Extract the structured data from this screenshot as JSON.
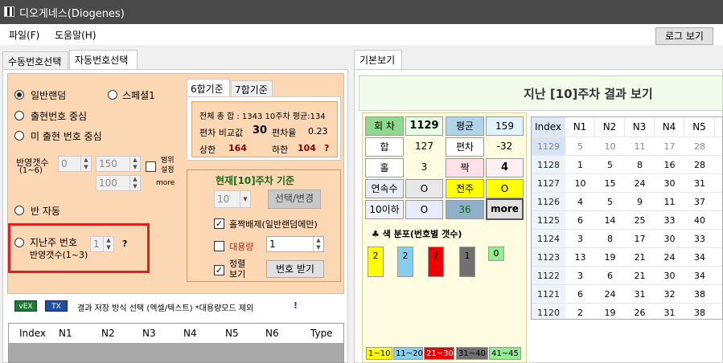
{
  "window": {
    "title": "디오게네스(Diogenes)"
  },
  "menu": {
    "file": "파일(F)",
    "help": "도움말(H)",
    "log_button": "로그 보기"
  },
  "left_tabs": {
    "manual": "수동번호선택",
    "auto": "자동번호선택"
  },
  "right_tabs": {
    "basic": "기본보기"
  },
  "options": {
    "normal_random": "일반랜덤",
    "special1": "스페셜1",
    "drawn_center": "출현번호 중심",
    "undrawn_center": "미 출현 번호 중심",
    "reflect_count_label": "반영갯수",
    "reflect_count_range": "(1~6)",
    "reflect_value": "0",
    "range_value1": "150",
    "range_value2": "100",
    "range_setting": "범위\n설정",
    "more": "more",
    "semi_auto": "반 자동",
    "last_week_number": "지난주 번호",
    "last_week_reflect": "반영갯수(1~3)",
    "last_week_value": "1",
    "question": "?"
  },
  "combo_tabs": {
    "six": "6합기준",
    "seven": "7합기준"
  },
  "summary": {
    "total_line": "전체 총 합 : 1343  10주차 평균:134",
    "deviation_label": "편차 비교값",
    "deviation_value": "30",
    "deviation_rate_label": "편차율",
    "deviation_rate": "0.23",
    "upper_label": "상한",
    "upper": "164",
    "lower_label": "하한",
    "lower": "104",
    "q": "?"
  },
  "current": {
    "title": "현재[10]주차 기준",
    "week_value": "10",
    "select_button": "선택/변경",
    "oddeven_exclude": "홀짝배제(일반랜덤에만)",
    "bulk_label": "대용량",
    "bulk_value": "1",
    "sort_label": "정렬\n보기",
    "get_numbers_button": "번호 받기"
  },
  "save": {
    "label": "결과 저장 방식 선택 (엑셀/텍스트) *대용량모드 제외",
    "excl": "!",
    "excel_icon": "vEX",
    "text_icon": "TX"
  },
  "bottom_table": {
    "headers": [
      "Index",
      "N1",
      "N2",
      "N3",
      "N4",
      "N5",
      "N6",
      "Type"
    ]
  },
  "result": {
    "title": "지난 [10]주차 결과 보기"
  },
  "stats": {
    "round_label": "회 차",
    "round": "1129",
    "avg_label": "평균",
    "avg": "159",
    "sum_label": "합",
    "sum": "127",
    "dev_label": "편차",
    "dev": "-32",
    "odd_label": "홀",
    "odd": "3",
    "even_label": "짝",
    "even": "4",
    "consec_label": "연속수",
    "consec": "O",
    "prev_label": "전주",
    "prev": "O",
    "under10_label": "10이하",
    "under10": "O",
    "s36": "36",
    "more_button": "more"
  },
  "color_dist": {
    "title": "♣ 색 분포(번호별 갯수)",
    "counts": [
      "2",
      "2",
      "2",
      "1",
      "0"
    ],
    "colors": [
      "#ffff00",
      "#87ceeb",
      "#ee0000",
      "#707070",
      "#90ee90"
    ],
    "legend": [
      "1~10",
      "11~20",
      "21~30",
      "31~40",
      "41~45"
    ]
  },
  "history": {
    "headers": [
      "Index",
      "N1",
      "N2",
      "N3",
      "N4",
      "N5"
    ],
    "rows": [
      [
        "1129",
        "5",
        "10",
        "11",
        "17",
        "28"
      ],
      [
        "1128",
        "1",
        "5",
        "8",
        "16",
        "28"
      ],
      [
        "1127",
        "10",
        "15",
        "24",
        "30",
        "31"
      ],
      [
        "1126",
        "4",
        "5",
        "9",
        "11",
        "37"
      ],
      [
        "1125",
        "6",
        "14",
        "25",
        "33",
        "40"
      ],
      [
        "1124",
        "3",
        "8",
        "17",
        "30",
        "33"
      ],
      [
        "1123",
        "13",
        "19",
        "21",
        "24",
        "34"
      ],
      [
        "1122",
        "3",
        "6",
        "21",
        "30",
        "34"
      ],
      [
        "1121",
        "6",
        "24",
        "31",
        "32",
        "38"
      ],
      [
        "1120",
        "2",
        "19",
        "26",
        "31",
        "38"
      ]
    ]
  }
}
